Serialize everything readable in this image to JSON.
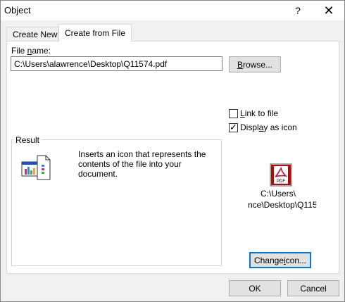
{
  "window": {
    "title": "Object",
    "help_glyph": "?",
    "close_glyph": "✕"
  },
  "tabs": [
    {
      "label": "Create New",
      "active": false
    },
    {
      "label": "Create from File",
      "active": true
    }
  ],
  "file": {
    "label_prefix": "File ",
    "label_underlined": "n",
    "label_suffix": "ame:",
    "value": "C:\\Users\\alawrence\\Desktop\\Q11574.pdf"
  },
  "browse": {
    "underlined": "B",
    "rest": "rowse..."
  },
  "options": {
    "link": {
      "underlined": "L",
      "rest": "ink to file",
      "checked": false
    },
    "display": {
      "pre": "Displ",
      "underlined": "a",
      "rest": "y as icon",
      "checked": true
    }
  },
  "result": {
    "legend": "Result",
    "text": "Inserts an icon that represents the contents of the file into your document."
  },
  "icon_preview": {
    "line1": "C:\\Users\\",
    "line2": "nce\\Desktop\\Q115",
    "pdf_label": "PDF"
  },
  "buttons": {
    "change_icon": {
      "pre": "Change ",
      "underlined": "i",
      "rest": "con..."
    },
    "ok": "OK",
    "cancel": "Cancel"
  },
  "colors": {
    "focus": "#0078d7",
    "pdf_red": "#c8102e"
  }
}
